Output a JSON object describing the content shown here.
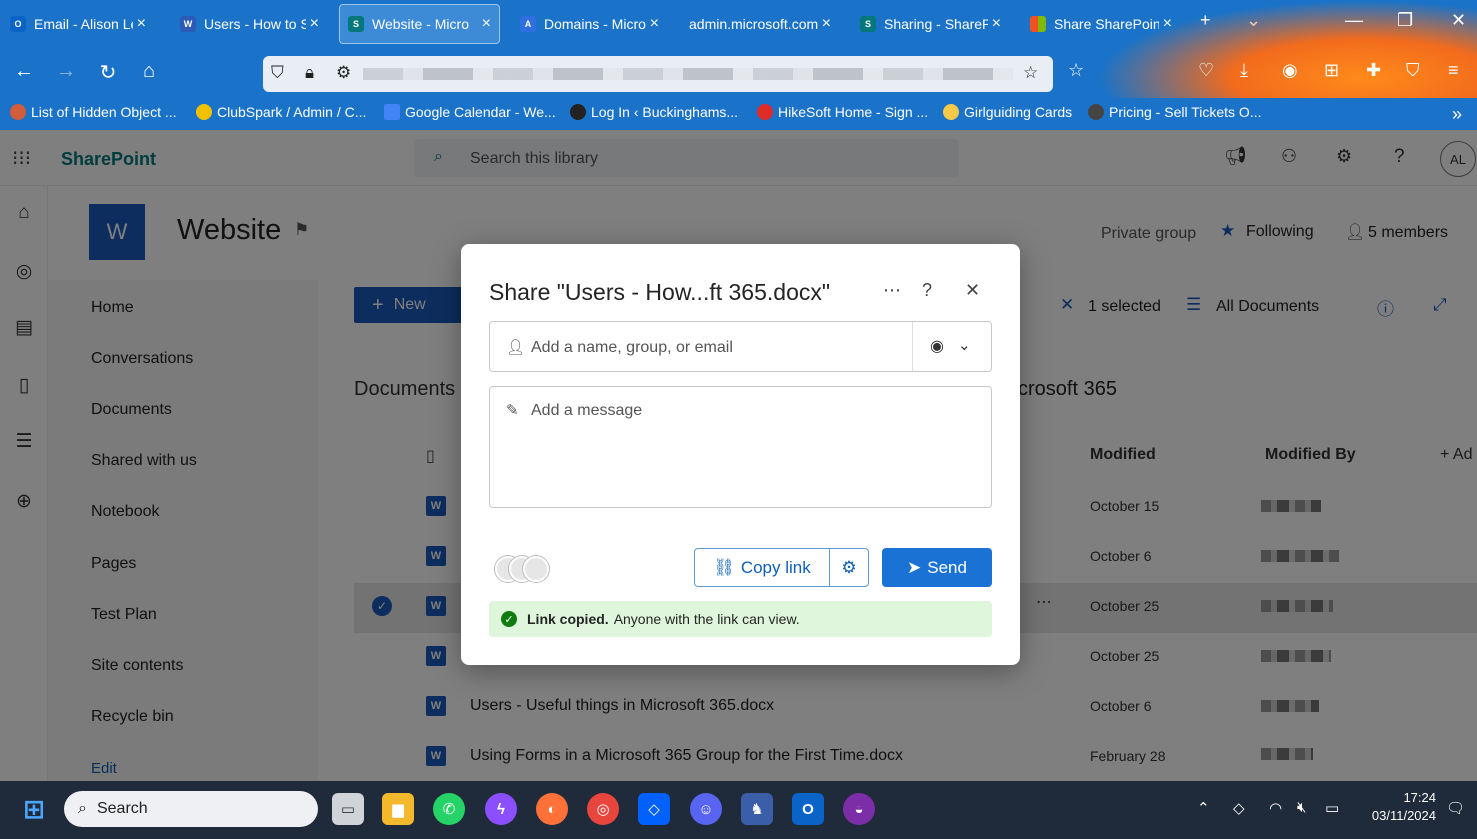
{
  "browser": {
    "tabs": [
      {
        "title": "Email - Alison Le",
        "icon_color": "#0a64c8"
      },
      {
        "title": "Users - How to S",
        "icon_color": "#2b5bb7"
      },
      {
        "title": "Website - Micro",
        "icon_color": "#03787c"
      },
      {
        "title": "Domains - Micro",
        "icon_color": "#2f6fe0"
      },
      {
        "title": "admin.microsoft.com",
        "icon_color": "#1a73c8"
      },
      {
        "title": "Sharing - ShareP",
        "icon_color": "#03787c"
      },
      {
        "title": "Share SharePoin",
        "icon_color": "#f25022"
      }
    ],
    "bookmarks": [
      {
        "label": "List of Hidden Object ...",
        "color": "#d35d3a"
      },
      {
        "label": "ClubSpark / Admin / C...",
        "color": "#f2c200"
      },
      {
        "label": "Google Calendar - We...",
        "color": "#4285f4"
      },
      {
        "label": "Log In ‹ Buckinghams...",
        "color": "#222222"
      },
      {
        "label": "HikeSoft Home - Sign ...",
        "color": "#e02b2b"
      },
      {
        "label": "Girlguiding Cards",
        "color": "#f7c948"
      },
      {
        "label": "Pricing - Sell Tickets O...",
        "color": "#444444"
      }
    ]
  },
  "sharepoint": {
    "app_name": "SharePoint",
    "search_placeholder": "Search this library",
    "user_initials": "AL",
    "site_logo_letter": "W",
    "site_name": "Website",
    "privacy": "Private group",
    "following_label": "Following",
    "members_label": "5 members",
    "new_button": "New",
    "selected_label": "1 selected",
    "view_label": "All Documents",
    "library_title": "Documents",
    "library_title_right": "crosoft 365",
    "left_nav": [
      "Home",
      "Conversations",
      "Documents",
      "Shared with us",
      "Notebook",
      "Pages",
      "Test Plan",
      "Site contents",
      "Recycle bin",
      "Edit"
    ],
    "columns": {
      "modified": "Modified",
      "modified_by": "Modified By",
      "add": "Ad"
    },
    "rows": [
      {
        "name": "",
        "modified": "October 15"
      },
      {
        "name": "",
        "modified": "October 6"
      },
      {
        "name": "",
        "modified": "October 25"
      },
      {
        "name": "",
        "modified": "October 25"
      },
      {
        "name": "Users - Useful things in Microsoft 365.docx",
        "modified": "October 6"
      },
      {
        "name": "Using Forms in a Microsoft 365 Group for the First Time.docx",
        "modified": "February 28"
      }
    ]
  },
  "dialog": {
    "title": "Share \"Users - How...ft 365.docx\"",
    "recipient_placeholder": "Add a name, group, or email",
    "message_placeholder": "Add a message",
    "copy_link": "Copy link",
    "send": "Send",
    "banner_bold": "Link copied.",
    "banner_text": "Anyone with the link can view."
  },
  "taskbar": {
    "search_label": "Search",
    "time": "17:24",
    "date": "03/11/2024"
  }
}
